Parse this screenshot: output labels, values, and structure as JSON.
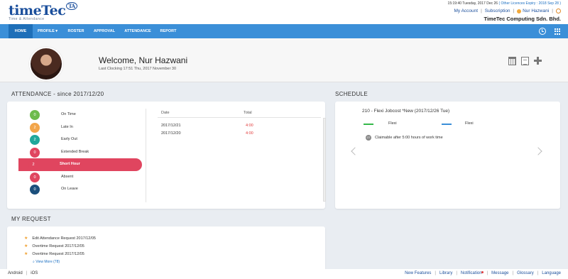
{
  "header": {
    "logo_main": "timeTec",
    "logo_badge": "TA",
    "logo_sub": "Time & Attendance",
    "datetime": "15:19:40 Tuesday, 2017 Dec 26",
    "licence": "( Other Licences Expiry : 2018 Sep 28 )",
    "links": {
      "my_account": "My Account",
      "subscription": "Subscription",
      "user_name": "Nur Hazwani"
    },
    "company": "TimeTec Computing Sdn. Bhd."
  },
  "nav": {
    "items": [
      "HOME",
      "PROFILE ▾",
      "ROSTER",
      "APPROVAL",
      "ATTENDANCE",
      "REPORT"
    ]
  },
  "welcome": {
    "title": "Welcome, Nur Hazwani",
    "last_clocking": "Last Clocking 17:51 Thu, 2017 November 30"
  },
  "attendance": {
    "section_title": "ATTENDANCE - since 2017/12/20",
    "statuses": [
      {
        "count": "0",
        "label": "On Time",
        "color": "#6dbb4c"
      },
      {
        "count": "2",
        "label": "Late In",
        "color": "#f2a54a"
      },
      {
        "count": "2",
        "label": "Early Out",
        "color": "#1fa79b"
      },
      {
        "count": "0",
        "label": "Extended Break",
        "color": "#e0455f"
      },
      {
        "count": "2",
        "label": "Short Hour",
        "color": "#e0455f"
      },
      {
        "count": "0",
        "label": "Absent",
        "color": "#e0455f"
      },
      {
        "count": "0",
        "label": "On Leave",
        "color": "#1b4f7c"
      }
    ],
    "table": {
      "col_date": "Date",
      "col_total": "Total",
      "rows": [
        {
          "date": "2017/12/21",
          "total": "4:00"
        },
        {
          "date": "2017/12/20",
          "total": "4:00"
        }
      ]
    }
  },
  "schedule": {
    "section_title": "SCHEDULE",
    "title": "210 - Flexi Jobcost *New (2017/12/26 Tue)",
    "in_label": "Flexi",
    "out_label": "Flexi",
    "badge": "OT",
    "note": "Claimable after 5:00 hours of work time"
  },
  "request": {
    "section_title": "MY REQUEST",
    "items": [
      "Edit Attendance Request 2017/12/05",
      "Overtime Request 2017/12/05",
      "Overtime Request 2017/12/05"
    ],
    "view_more": "View More (78)"
  },
  "footer": {
    "left": [
      "Android",
      "iOS"
    ],
    "right": [
      "New Features",
      "Library",
      "Notification",
      "Message",
      "Glossary",
      "Language"
    ]
  },
  "colors": {
    "nav_blue": "#3b8fd8",
    "nav_active": "#1e6fb8",
    "brand": "#1b4f9c",
    "active_row": "#e0455f",
    "total_red": "#e23b3b"
  }
}
